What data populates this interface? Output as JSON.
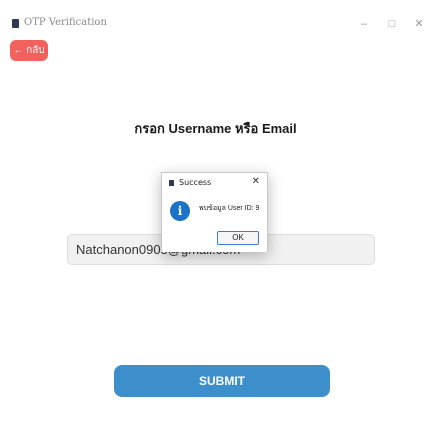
{
  "window": {
    "title": "OTP Verification",
    "controls": {
      "minimize": "–",
      "maximize": "□",
      "close": "✕"
    }
  },
  "back_button": {
    "label": "← กลับ"
  },
  "heading": "กรอก Username หรือ Email",
  "input": {
    "value": "Natchanon0905@gmail.com"
  },
  "submit": {
    "label": "SUBMIT"
  },
  "dialog": {
    "title": "Success",
    "close": "✕",
    "message": "พบข้อมูล User ID: 9",
    "ok_label": "OK"
  },
  "colors": {
    "accent": "#3d8fcc",
    "back_button": "#f2615e",
    "info_icon": "#1a73c9"
  },
  "icons": {
    "app": "app-icon",
    "info": "info-icon"
  }
}
